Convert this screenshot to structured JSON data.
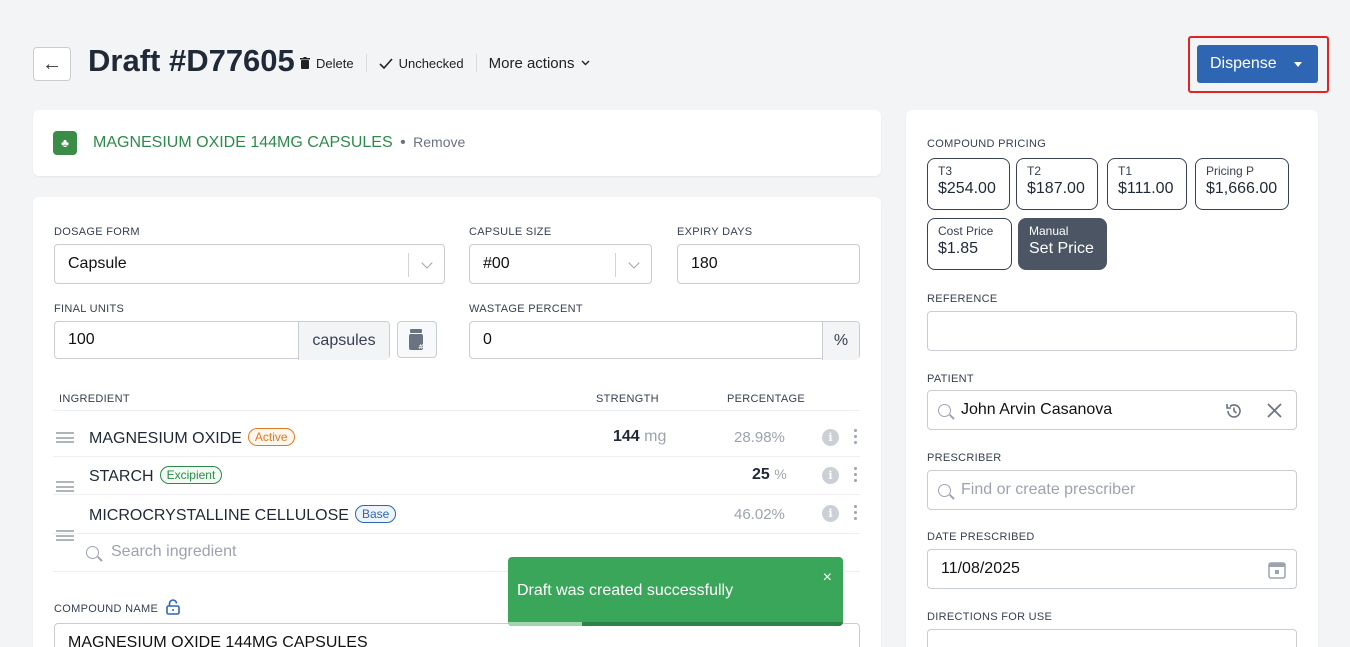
{
  "header": {
    "title": "Draft #D77605",
    "delete_label": "Delete",
    "unchecked_label": "Unchecked",
    "more_actions_label": "More actions",
    "dispense_label": "Dispense"
  },
  "product": {
    "name": "MAGNESIUM OXIDE 144MG CAPSULES",
    "separator": "•",
    "remove_label": "Remove"
  },
  "form": {
    "dosage_form": {
      "label": "DOSAGE FORM",
      "value": "Capsule"
    },
    "capsule_size": {
      "label": "CAPSULE SIZE",
      "value": "#00"
    },
    "expiry_days": {
      "label": "EXPIRY DAYS",
      "value": "180"
    },
    "final_units": {
      "label": "FINAL UNITS",
      "value": "100",
      "unit": "capsules"
    },
    "wastage_percent": {
      "label": "WASTAGE PERCENT",
      "value": "0",
      "unit": "%"
    }
  },
  "ingredients": {
    "headers": {
      "ingredient": "INGREDIENT",
      "strength": "STRENGTH",
      "percentage": "PERCENTAGE"
    },
    "rows": [
      {
        "name": "MAGNESIUM OXIDE",
        "badge": "Active",
        "strength_value": "144",
        "strength_unit": "mg",
        "percentage": "28.98%"
      },
      {
        "name": "STARCH",
        "badge": "Excipient",
        "strength_value": "",
        "strength_unit": "",
        "percentage_value": "25",
        "percentage_unit": "%"
      },
      {
        "name": "MICROCRYSTALLINE CELLULOSE",
        "badge": "Base",
        "strength_value": "",
        "strength_unit": "",
        "percentage": "46.02%"
      }
    ],
    "search_placeholder": "Search ingredient"
  },
  "compound_name": {
    "label": "COMPOUND NAME",
    "value": "MAGNESIUM OXIDE 144MG CAPSULES"
  },
  "pricing": {
    "label": "COMPOUND PRICING",
    "tiers": [
      {
        "label": "T3",
        "value": "$254.00"
      },
      {
        "label": "T2",
        "value": "$187.00"
      },
      {
        "label": "T1",
        "value": "$111.00"
      },
      {
        "label": "Pricing P",
        "value": "$1,666.00"
      },
      {
        "label": "Cost Price",
        "value": "$1.85"
      },
      {
        "label": "Manual",
        "value": "Set Price"
      }
    ]
  },
  "reference": {
    "label": "REFERENCE",
    "value": ""
  },
  "patient": {
    "label": "PATIENT",
    "value": "John Arvin Casanova"
  },
  "prescriber": {
    "label": "PRESCRIBER",
    "placeholder": "Find or create prescriber"
  },
  "date_prescribed": {
    "label": "DATE PRESCRIBED",
    "value": "11/08/2025"
  },
  "directions": {
    "label": "DIRECTIONS FOR USE"
  },
  "toast": {
    "message": "Draft was created successfully",
    "close": "×",
    "progress": 0.22
  },
  "icons": [
    "back-arrow-icon",
    "trash-icon",
    "check-icon",
    "chevron-down-icon",
    "pill-bottle-icon",
    "drag-handle-icon",
    "info-icon",
    "kebab-icon",
    "search-icon",
    "history-icon",
    "close-icon",
    "lock-icon",
    "calendar-icon"
  ],
  "colors": {
    "primary": "#2f66b3",
    "success": "#3aa65a",
    "highlight": "#e02424"
  }
}
